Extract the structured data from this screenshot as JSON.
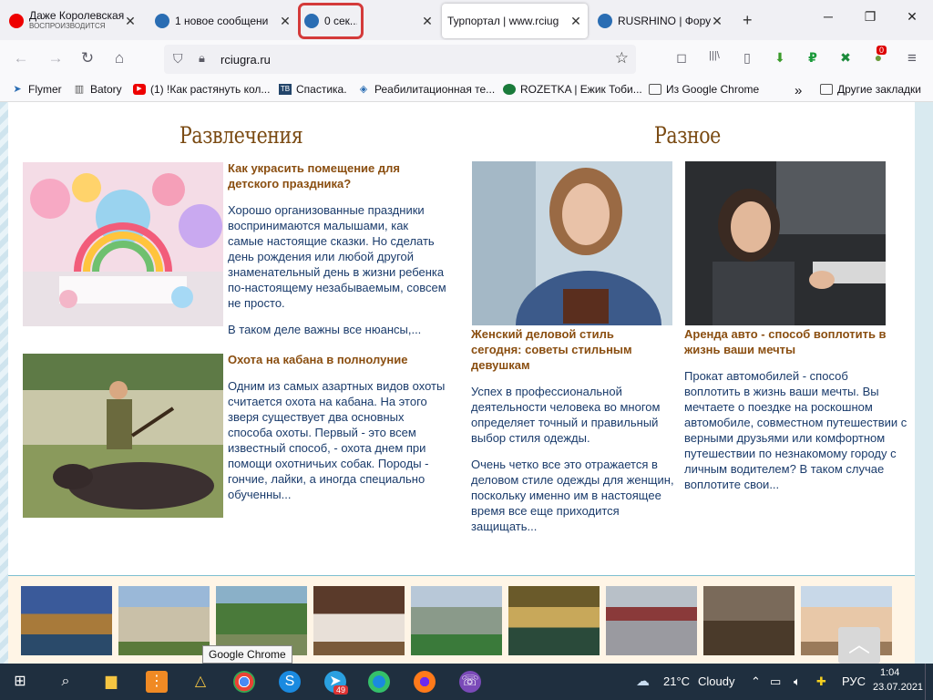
{
  "tabs": [
    {
      "title": "Даже Королевская",
      "subtitle": "ВОСПРОИЗВОДИТСЯ",
      "close": "✕"
    },
    {
      "title": "1 новое сообщени",
      "close": "✕"
    },
    {
      "title": "0 сек...",
      "close": "✕"
    },
    {
      "title": "Турпортал | www.rciug",
      "close": "✕"
    },
    {
      "title": "RUSRHINO | Форум",
      "close": "✕"
    }
  ],
  "newtab": "+",
  "window": {
    "minimize": "─",
    "maximize": "❐",
    "close": "✕"
  },
  "nav": {
    "back": "←",
    "forward": "→",
    "reload": "↻",
    "home": "⌂",
    "url": "rciugra.ru",
    "star": "☆",
    "menu": "≡"
  },
  "extensions": {
    "pocket": "◻",
    "library": "|||\\",
    "sidebar": "▯",
    "ext1": "⬇",
    "ruble": "₽",
    "ext2": "✖",
    "badge": "0"
  },
  "bookmarks": [
    {
      "label": "Flymer"
    },
    {
      "label": "Batory"
    },
    {
      "label": "(1) !Как растянуть кол..."
    },
    {
      "label": "Спастика."
    },
    {
      "label": "Реабилитационная те..."
    },
    {
      "label": "ROZETKA | Ежик Тоби..."
    },
    {
      "label": "Из Google Chrome"
    },
    {
      "label": "»"
    },
    {
      "label": "Другие закладки"
    }
  ],
  "main": {
    "left_title": "Развлечения",
    "right_title": "Разное",
    "articles": [
      {
        "title": "Как украсить помещение для детского праздника?",
        "text": "Хорошо организованные праздники воспринимаются малышами, как самые настоящие сказки. Но сделать день рождения или любой другой знаменательный день в жизни ребенка по-настоящему незабываемым, совсем не просто.",
        "more": "В таком деле важны все нюансы,..."
      },
      {
        "title": "Охота на кабана в полнолуние",
        "text": "Одним из самых азартных видов охоты считается охота на кабана. На этого зверя существует два основных способа охоты. Первый - это всем известный способ, - охота днем при помощи охотничьих собак. Породы - гончие, лайки, а иногда специально обученны..."
      },
      {
        "title": "Женский деловой стиль сегодня: советы стильным девушкам",
        "text": "Успех в профессиональной деятельности человека во многом определяет точный и правильный выбор стиля одежды.",
        "more": "Очень четко все это отражается в деловом стиле одежды для женщин, поскольку именно им в настоящее время все еще приходится защищать..."
      },
      {
        "title": "Аренда авто - способ воплотить в жизнь ваши мечты",
        "text": "Прокат автомобилей - способ воплотить в жизнь ваши мечты. Вы мечтаете о поездке на роскошном автомобиле, совместном путешествии с верными друзьями или комфортном путешествии по незнакомому городу с личным водителем? В таком случае воплотите свои..."
      }
    ],
    "totop": "︿",
    "tooltip": "Google Chrome"
  },
  "taskbar": {
    "temp": "21°C",
    "weather": "Cloudy",
    "lang": "РУС",
    "time": "1:04",
    "date": "23.07.2021",
    "telegram_badge": "49"
  }
}
